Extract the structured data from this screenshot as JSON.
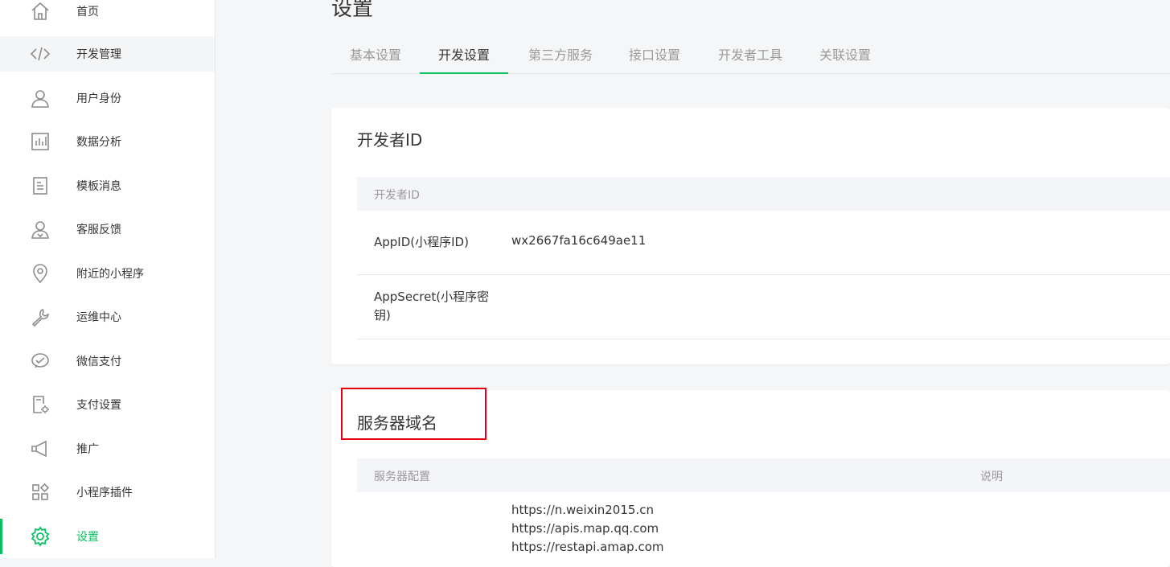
{
  "sidebar": {
    "items": [
      {
        "label": "首页",
        "icon": "home-icon"
      },
      {
        "label": "开发管理",
        "icon": "code-icon"
      },
      {
        "label": "用户身份",
        "icon": "user-icon"
      },
      {
        "label": "数据分析",
        "icon": "bar-chart-icon"
      },
      {
        "label": "模板消息",
        "icon": "document-icon"
      },
      {
        "label": "客服反馈",
        "icon": "customer-service-icon"
      },
      {
        "label": "附近的小程序",
        "icon": "location-pin-icon"
      },
      {
        "label": "运维中心",
        "icon": "wrench-icon"
      },
      {
        "label": "微信支付",
        "icon": "wechat-pay-icon"
      },
      {
        "label": "支付设置",
        "icon": "payment-settings-icon"
      },
      {
        "label": "推广",
        "icon": "megaphone-icon"
      },
      {
        "label": "小程序插件",
        "icon": "plugin-grid-icon"
      },
      {
        "label": "设置",
        "icon": "gear-icon"
      }
    ],
    "active_index": 12,
    "hover_index": 1
  },
  "header": {
    "title": "设置"
  },
  "tabs": [
    {
      "label": "基本设置"
    },
    {
      "label": "开发设置"
    },
    {
      "label": "第三方服务"
    },
    {
      "label": "接口设置"
    },
    {
      "label": "开发者工具"
    },
    {
      "label": "关联设置"
    }
  ],
  "active_tab": 1,
  "developer_id_card": {
    "title": "开发者ID",
    "table_header": "开发者ID",
    "rows": [
      {
        "key": "AppID(小程序ID)",
        "value": "wx2667fa16c649ae11"
      },
      {
        "key": "AppSecret(小程序密钥)",
        "value": ""
      }
    ]
  },
  "server_domain_card": {
    "title": "服务器域名",
    "columns": [
      "服务器配置",
      "说明"
    ],
    "domains": [
      "https://n.weixin2015.cn",
      "https://apis.map.qq.com",
      "https://restapi.amap.com"
    ]
  },
  "colors": {
    "accent": "#07c160",
    "highlight_box": "#e60012"
  }
}
